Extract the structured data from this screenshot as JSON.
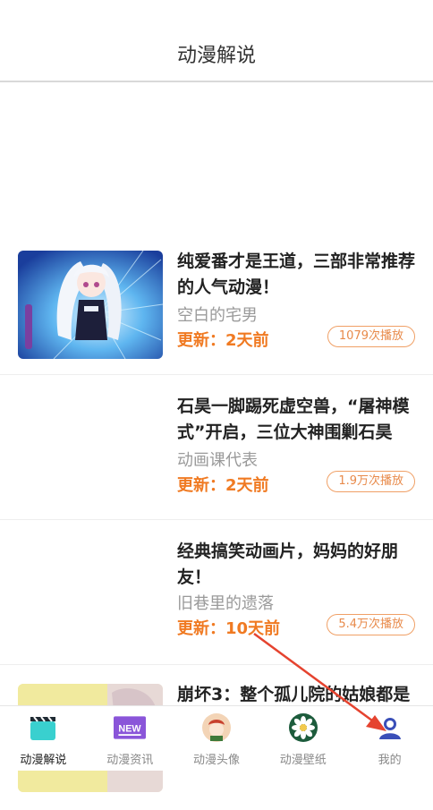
{
  "header": {
    "title": "动漫解说"
  },
  "feed": [
    {
      "title": "纯爱番才是王道，三部非常推荐的人气动漫！",
      "author": "空白的宅男",
      "updated": "更新：2天前",
      "plays": "1079次播放",
      "has_thumbnail": true
    },
    {
      "title": "石昊一脚踢死虚空兽，“屠神模式”开启，三位大神围剿石昊",
      "author": "动画课代表",
      "updated": "更新：2天前",
      "plays": "1.9万次播放",
      "has_thumbnail": false
    },
    {
      "title": "经典搞笑动画片，妈妈的好朋友！",
      "author": "旧巷里的遗落",
      "updated": "更新：10天前",
      "plays": "5.4万次播放",
      "has_thumbnail": false
    },
    {
      "title": "崩坏3：整个孤儿院的姑娘都是",
      "has_thumbnail": true
    }
  ],
  "tabbar": {
    "items": [
      {
        "label": "动漫解说",
        "icon": "clapperboard-icon",
        "active": true
      },
      {
        "label": "动漫资讯",
        "icon": "new-badge-icon",
        "icon_text": "NEW",
        "active": false
      },
      {
        "label": "动漫头像",
        "icon": "avatar-icon",
        "active": false
      },
      {
        "label": "动漫壁纸",
        "icon": "flower-icon",
        "active": false
      },
      {
        "label": "我的",
        "icon": "user-icon",
        "active": false
      }
    ]
  },
  "colors": {
    "accent_update": "#f07a22",
    "annotation_arrow": "#e5432f",
    "clapper_teal": "#39d0cf",
    "news_purple": "#8a55d9",
    "wallpaper_green": "#1d5c3c",
    "user_blue": "#3a4fb8"
  }
}
